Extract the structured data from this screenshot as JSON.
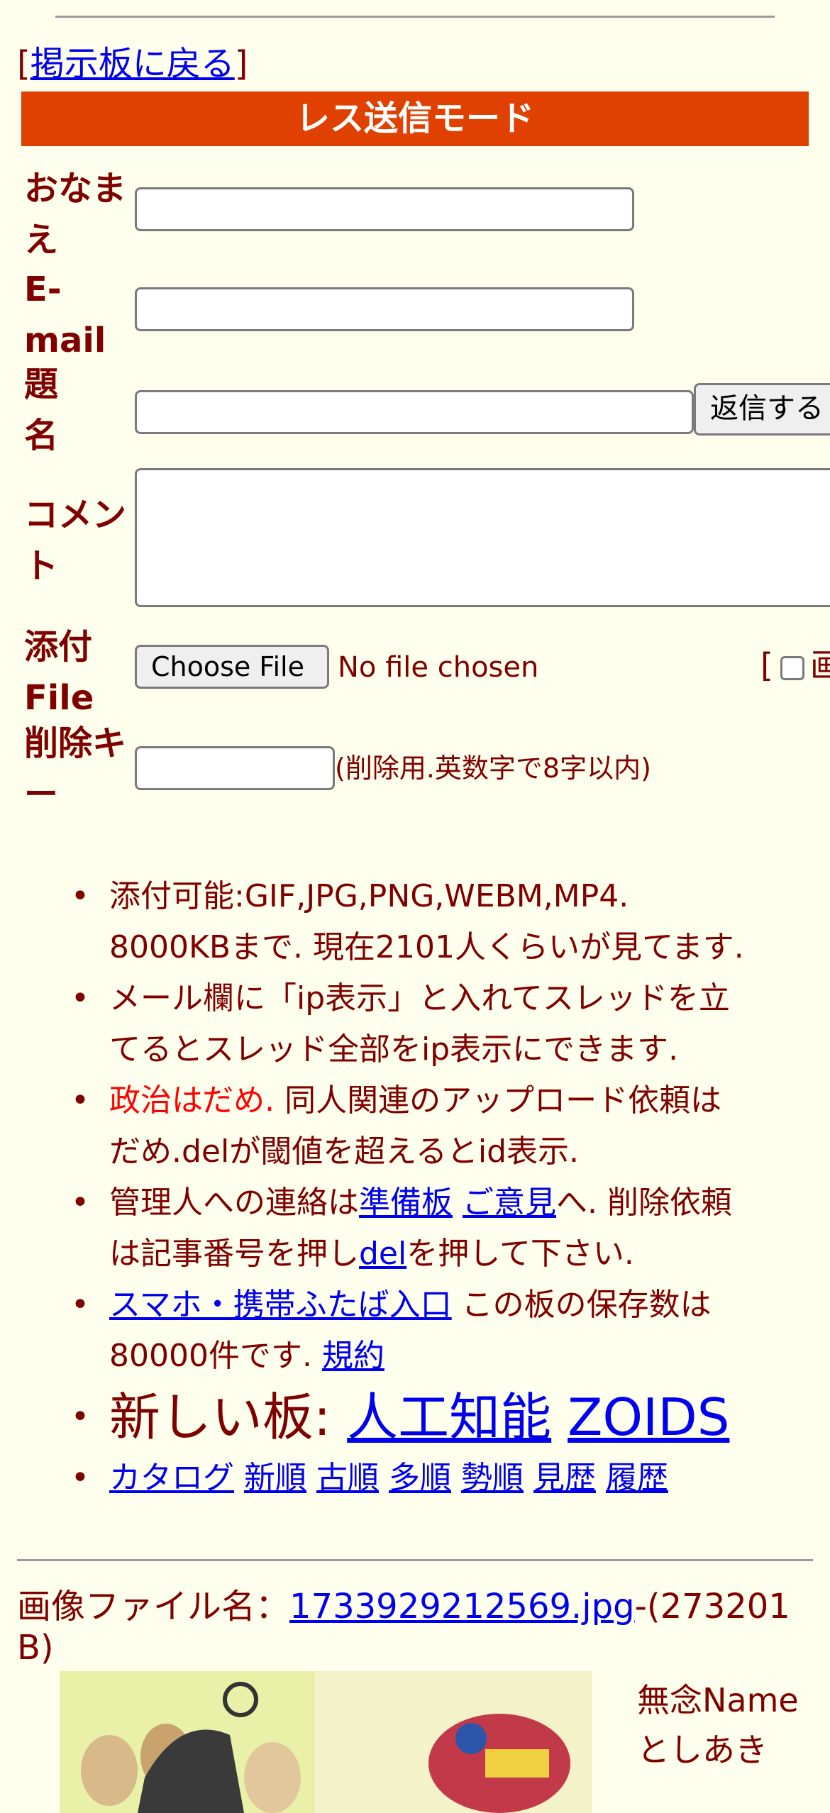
{
  "back": {
    "bracket_open": "[",
    "link": "掲示板に戻る",
    "bracket_close": "]"
  },
  "mode_title": "レス送信モード",
  "form": {
    "name_label_line1": "おなま",
    "name_label_line2": "え",
    "email_label_line1": "E-",
    "email_label_line2": "mail",
    "subject_label_line1": "題",
    "subject_label_line2": "名",
    "submit_label": "返信する",
    "comment_label_line1": "コメン",
    "comment_label_line2": "ト",
    "file_label_line1": "添付",
    "file_label_line2": "File",
    "choose_file": "Choose File",
    "no_file": "No file chosen",
    "image_check_bracket": "[",
    "image_check_text": "画",
    "delkey_label_line1": "削除キ",
    "delkey_label_line2": "ー",
    "delkey_note": "(削除用.英数字で8字以内)"
  },
  "info": {
    "b1": "添付可能:GIF,JPG,PNG,WEBM,MP4.",
    "b1b": "8000KBまで. 現在2101人くらいが見てます.",
    "b2": "メール欄に「ip表示」と入れてスレッドを立",
    "b2b": "てるとスレッド全部をip表示にできます.",
    "b3_red": "政治はだめ.",
    "b3": " 同人関連のアップロード依頼は",
    "b3b": "だめ.delが閾値を超えるとid表示.",
    "b4_pre": "管理人への連絡は",
    "b4_link1": "準備板",
    "b4_link2": "ご意見",
    "b4_post": "へ. 削除依頼",
    "b4b_pre": "は記事番号を押し",
    "b4b_link": "del",
    "b4b_post": "を押して下さい.",
    "b5_link": "スマホ・携帯ふたば入口",
    "b5": " この板の保存数は",
    "b5b": "80000件です. ",
    "b5b_link": "規約",
    "b6_label": "新しい板: ",
    "b6_link1": "人工知能",
    "b6_link2": "ZOIDS",
    "nav": [
      "カタログ",
      "新順",
      "古順",
      "多順",
      "勢順",
      "見歴",
      "履歴"
    ]
  },
  "post": {
    "file_label": "画像ファイル名：",
    "file_link": "1733929212569.jpg",
    "file_size_a": "-(273201",
    "file_size_b": "B)",
    "name1": "無念Name",
    "name2": "としあき"
  }
}
